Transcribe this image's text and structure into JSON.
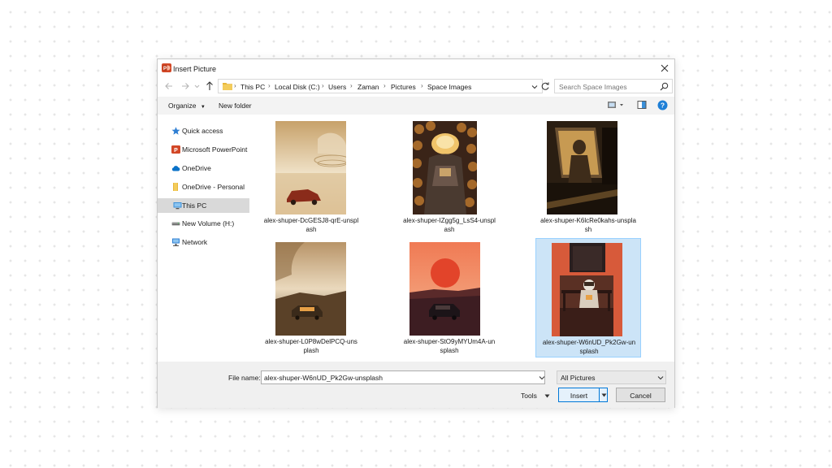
{
  "dialog": {
    "title": "Insert Picture",
    "icons": {
      "app": "powerpoint-icon",
      "close": "close-icon"
    }
  },
  "address_bar": {
    "breadcrumbs": [
      "This PC",
      "Local Disk (C:)",
      "Users",
      "Zaman",
      "Pictures",
      "Space Images"
    ],
    "search_placeholder": "Search Space Images",
    "icons": [
      "back-arrow-icon",
      "forward-arrow-icon",
      "up-arrow-icon",
      "folder-icon",
      "refresh-icon",
      "search-icon"
    ]
  },
  "toolbar": {
    "organize_label": "Organize",
    "new_folder_label": "New folder",
    "icons": [
      "view-options-icon",
      "preview-pane-icon",
      "help-icon"
    ]
  },
  "navigation": {
    "items": [
      {
        "label": "Quick access",
        "icon": "star-icon",
        "color": "#2f7fd3"
      },
      {
        "label": "Microsoft PowerPoint",
        "icon": "powerpoint-icon",
        "color": "#d24726"
      },
      {
        "label": "OneDrive",
        "icon": "cloud-icon",
        "color": "#0a72c8"
      },
      {
        "label": "OneDrive - Personal",
        "icon": "folder-icon",
        "color": "#e8b73a"
      },
      {
        "label": "This PC",
        "icon": "computer-icon",
        "color": "#3a8fd8",
        "selected": true
      },
      {
        "label": "New Volume (H:)",
        "icon": "drive-icon",
        "color": "#7a7a7a"
      },
      {
        "label": "Network",
        "icon": "network-icon",
        "color": "#2f7fd3"
      }
    ]
  },
  "files": [
    {
      "name": "alex-shuper-DcGESJ8-qrE-unsplash",
      "label_line1": "alex-shuper-DcGESJ8-qrE-unspl",
      "label_line2": "ash"
    },
    {
      "name": "alex-shuper-IZgg5g_LsS4-unsplash",
      "label_line1": "alex-shuper-IZgg5g_LsS4-unspl",
      "label_line2": "ash"
    },
    {
      "name": "alex-shuper-K6lcRe0kahs-unsplash",
      "label_line1": "alex-shuper-K6lcRe0kahs-unspla",
      "label_line2": "sh"
    },
    {
      "name": "alex-shuper-L0P8wDelPCQ-unsplash",
      "label_line1": "alex-shuper-L0P8wDelPCQ-uns",
      "label_line2": "plash"
    },
    {
      "name": "alex-shuper-StO9yMYUm4A-unsplash",
      "label_line1": "alex-shuper-StO9yMYUm4A-un",
      "label_line2": "splash"
    },
    {
      "name": "alex-shuper-W6nUD_Pk2Gw-unsplash",
      "label_line1": "alex-shuper-W6nUD_Pk2Gw-un",
      "label_line2": "splash",
      "selected": true
    }
  ],
  "footer": {
    "file_name_label": "File name:",
    "file_name_value": "alex-shuper-W6nUD_Pk2Gw-unsplash",
    "file_type": "All Pictures",
    "tools_label": "Tools",
    "insert_label": "Insert",
    "cancel_label": "Cancel"
  },
  "colors": {
    "accent": "#0078d7",
    "selection": "#cce4f7",
    "nav_selected": "#d9d9d9",
    "toolbar_bg": "#f3f3f3",
    "footer_bg": "#f0f0f0"
  }
}
